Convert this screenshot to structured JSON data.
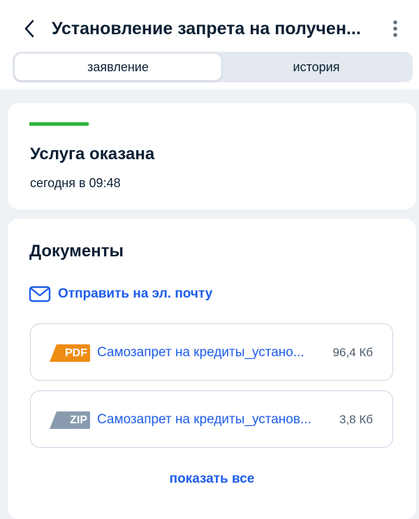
{
  "header": {
    "title": "Установление запрета на получен...",
    "back_icon": "chevron-left-icon",
    "menu_icon": "more-vertical-icon"
  },
  "tabs": [
    {
      "label": "заявление",
      "active": true
    },
    {
      "label": "история",
      "active": false
    }
  ],
  "status": {
    "title": "Услуга оказана",
    "time": "сегодня в 09:48",
    "color": "#2eb53b"
  },
  "documents": {
    "title": "Документы",
    "send_email_label": "Отправить на эл. почту",
    "send_email_icon": "mail-icon",
    "files": [
      {
        "type": "PDF",
        "name": "Самозапрет на кредиты_устано...",
        "size": "96,4 Кб",
        "badge_color": "#ee8c13"
      },
      {
        "type": "ZIP",
        "name": "Самозапрет на кредиты_установ...",
        "size": "3,8 Кб",
        "badge_color": "#8a9bb0"
      }
    ],
    "show_all_label": "показать все"
  },
  "colors": {
    "accent": "#1d5deb",
    "text": "#0b1f33",
    "background": "#eef2f7"
  }
}
